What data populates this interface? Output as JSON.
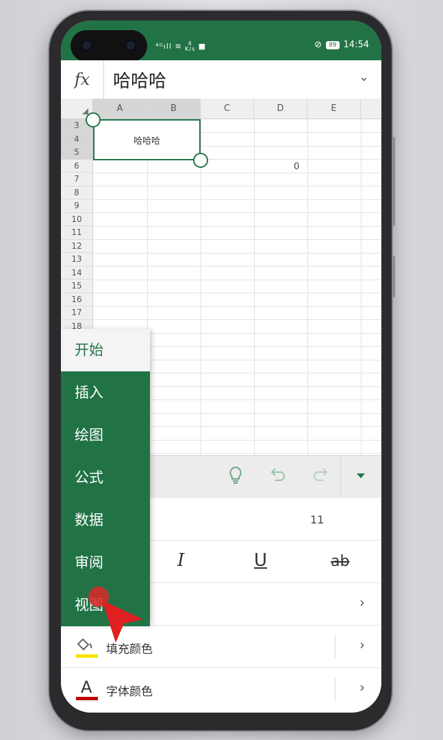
{
  "status_bar": {
    "network_left": "⁴ᴳıll",
    "speed_top": "4",
    "speed_bottom": "K/s",
    "battery": "89",
    "time": "14:54"
  },
  "formula_bar": {
    "fx_label": "fx",
    "value": "哈哈哈"
  },
  "sheet": {
    "columns": [
      "A",
      "B",
      "C",
      "D",
      "E"
    ],
    "rows": [
      "3",
      "4",
      "5",
      "6",
      "7",
      "8",
      "9",
      "10",
      "11",
      "12",
      "13",
      "14",
      "15",
      "16",
      "17",
      "18"
    ],
    "selected_cell_text": "哈哈哈",
    "d6_value": "0"
  },
  "tabs_menu": {
    "items": [
      "开始",
      "插入",
      "绘图",
      "公式",
      "数据",
      "审阅",
      "视图"
    ],
    "active": "开始"
  },
  "ribbon": {
    "font_size": "11",
    "italic_label": "I",
    "underline_label": "U",
    "strike_label": "ab",
    "fill_color_label": "填充颜色",
    "font_color_label": "字体颜色",
    "font_color_glyph": "A",
    "fill_swatch_color": "#f5e400",
    "font_swatch_color": "#c00000"
  },
  "colors": {
    "accent": "#217346"
  }
}
